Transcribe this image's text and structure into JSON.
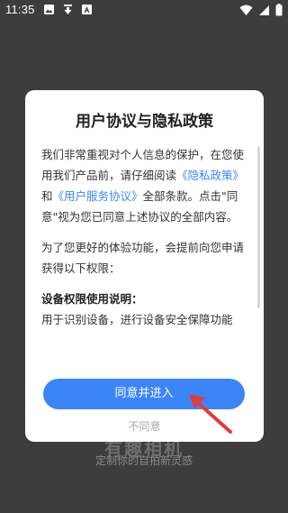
{
  "status_bar": {
    "time": "11:35",
    "left_icons": [
      "image-icon",
      "download-icon",
      "a-icon"
    ],
    "right_icons": [
      "wifi-icon",
      "cellular-icon",
      "battery-icon"
    ]
  },
  "background": {
    "title": "有趣相机",
    "subtitle": "定制你的自拍新灵感"
  },
  "dialog": {
    "title": "用户协议与隐私政策",
    "p1_pre": "我们非常重视对个人信息的保护，在您使用我们产品前，请仔细阅读",
    "privacy_link": "《隐私政策》",
    "p1_and": "和",
    "user_link": "《用户服务协议》",
    "p1_post": "全部条款。点击\"同意\"视为您已同意上述协议的全部内容。",
    "p2": "为了您更好的体验功能，会提前向您申请获得以下权限：",
    "p3_heading": "设备权限使用说明：",
    "p4": "用于识别设备，进行设备安全保障功能",
    "agree_label": "同意并进入",
    "disagree_label": "不同意"
  },
  "colors": {
    "accent": "#3c85f7",
    "link": "#3b87f5",
    "arrow": "#e23b3b"
  }
}
